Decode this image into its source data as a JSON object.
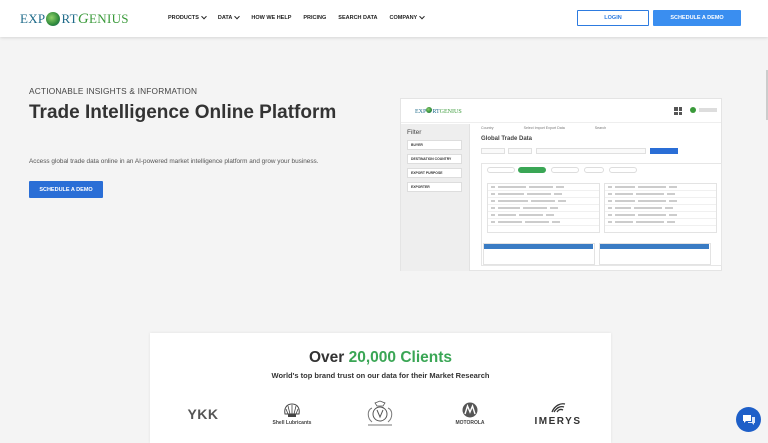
{
  "header": {
    "logo_left": "EXP",
    "logo_mid": "RT",
    "logo_right": "ENIUS",
    "logo_g": "G",
    "nav": [
      {
        "label": "PRODUCTS",
        "has_menu": true
      },
      {
        "label": "DATA",
        "has_menu": true
      },
      {
        "label": "HOW WE HELP",
        "has_menu": false
      },
      {
        "label": "PRICING",
        "has_menu": false
      },
      {
        "label": "SEARCH DATA",
        "has_menu": false
      },
      {
        "label": "COMPANY",
        "has_menu": true
      }
    ],
    "login_label": "LOGIN",
    "demo_label": "SCHEDULE A DEMO"
  },
  "hero": {
    "eyebrow": "ACTIONABLE INSIGHTS & INFORMATION",
    "title": "Trade Intelligence Online Platform",
    "subtitle": "Access global trade data online in an AI-powered market intelligence platform and grow your business.",
    "cta_label": "SCHEDULE A DEMO"
  },
  "mockup": {
    "filter_title": "Filter",
    "filter_items": [
      "BUYER",
      "DESTINATION COUNTRY",
      "EXPORT PURPOSE",
      "EXPORTER"
    ],
    "tabs": [
      "Country",
      "Select Import Export Data",
      "Search"
    ],
    "title": "Global Trade Data"
  },
  "clients": {
    "title_prefix": "Over ",
    "title_number": "20,000 Clients",
    "subtitle": "World's top brand trust on our data for their Market Research",
    "brands": {
      "ykk": "YKK",
      "shell": "Shell Lubricants",
      "motorola": "MOTOROLA",
      "imerys": "IMERYS"
    }
  },
  "colors": {
    "primary_blue": "#2a6ed6",
    "accent_green": "#3aa655",
    "chat_blue": "#1e5fc8"
  }
}
